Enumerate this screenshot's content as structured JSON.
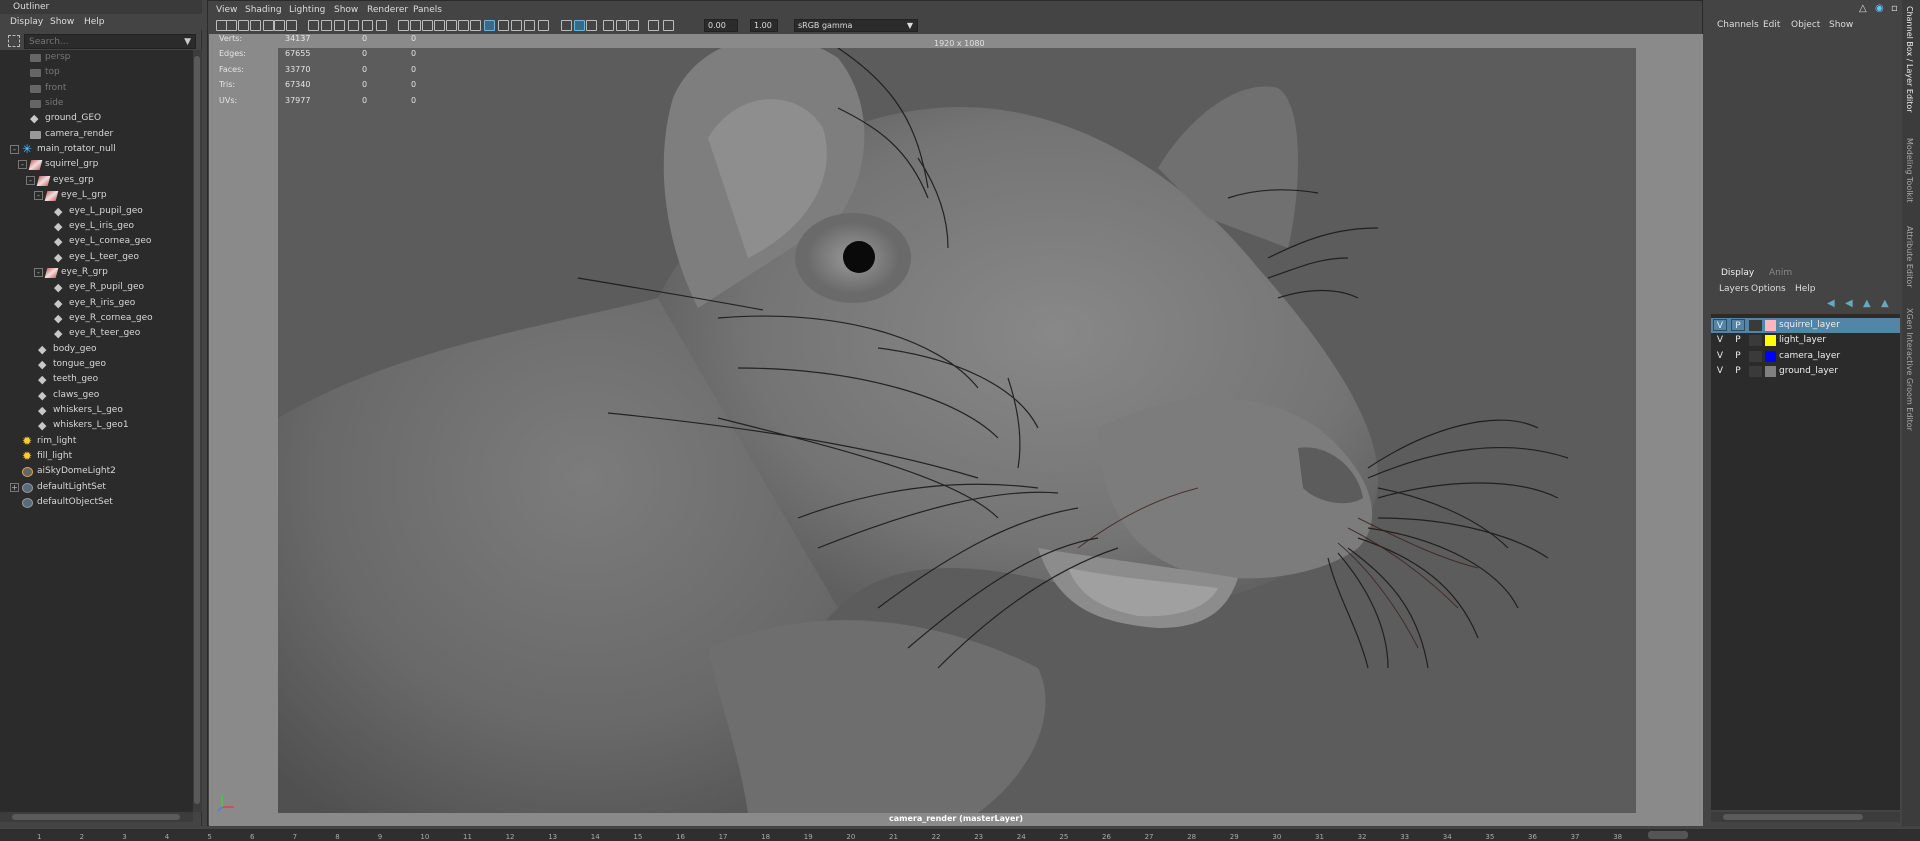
{
  "outliner": {
    "title": "Outliner",
    "menus": [
      "Display",
      "Show",
      "Help"
    ],
    "search_placeholder": "Search...",
    "items": [
      {
        "label": "persp",
        "type": "camera",
        "dim": true
      },
      {
        "label": "top",
        "type": "camera",
        "dim": true
      },
      {
        "label": "front",
        "type": "camera",
        "dim": true
      },
      {
        "label": "side",
        "type": "camera",
        "dim": true
      },
      {
        "label": "ground_GEO",
        "type": "mesh"
      },
      {
        "label": "camera_render",
        "type": "camera"
      },
      {
        "label": "main_rotator_null",
        "type": "null",
        "expanded": true
      },
      {
        "label": "squirrel_grp",
        "type": "group",
        "expanded": true
      },
      {
        "label": "eyes_grp",
        "type": "group",
        "expanded": true
      },
      {
        "label": "eye_L_grp",
        "type": "group",
        "expanded": true
      },
      {
        "label": "eye_L_pupil_geo",
        "type": "mesh"
      },
      {
        "label": "eye_L_iris_geo",
        "type": "mesh"
      },
      {
        "label": "eye_L_cornea_geo",
        "type": "mesh"
      },
      {
        "label": "eye_L_teer_geo",
        "type": "mesh"
      },
      {
        "label": "eye_R_grp",
        "type": "group",
        "expanded": true
      },
      {
        "label": "eye_R_pupil_geo",
        "type": "mesh"
      },
      {
        "label": "eye_R_iris_geo",
        "type": "mesh"
      },
      {
        "label": "eye_R_cornea_geo",
        "type": "mesh"
      },
      {
        "label": "eye_R_teer_geo",
        "type": "mesh"
      },
      {
        "label": "body_geo",
        "type": "mesh"
      },
      {
        "label": "tongue_geo",
        "type": "mesh"
      },
      {
        "label": "teeth_geo",
        "type": "mesh"
      },
      {
        "label": "claws_geo",
        "type": "mesh"
      },
      {
        "label": "whiskers_L_geo",
        "type": "mesh"
      },
      {
        "label": "whiskers_L_geo1",
        "type": "mesh"
      },
      {
        "label": "rim_light",
        "type": "light"
      },
      {
        "label": "fill_light",
        "type": "light"
      },
      {
        "label": "aiSkyDomeLight2",
        "type": "dome"
      },
      {
        "label": "defaultLightSet",
        "type": "set",
        "expandable": true
      },
      {
        "label": "defaultObjectSet",
        "type": "set"
      }
    ]
  },
  "viewport": {
    "menus": [
      "View",
      "Shading",
      "Lighting",
      "Show",
      "Renderer",
      "Panels"
    ],
    "exposure": "0.00",
    "gamma": "1.00",
    "color_space": "sRGB gamma",
    "resolution": "1920 x 1080",
    "camera_label": "camera_render (masterLayer)",
    "hud": [
      {
        "name": "Verts:",
        "values": [
          "34137",
          "0",
          "0"
        ]
      },
      {
        "name": "Edges:",
        "values": [
          "67655",
          "0",
          "0"
        ]
      },
      {
        "name": "Faces:",
        "values": [
          "33770",
          "0",
          "0"
        ]
      },
      {
        "name": "Tris:",
        "values": [
          "67340",
          "0",
          "0"
        ]
      },
      {
        "name": "UVs:",
        "values": [
          "37977",
          "0",
          "0"
        ]
      }
    ]
  },
  "channel_box": {
    "menus": [
      "Channels",
      "Edit",
      "Object",
      "Show"
    ]
  },
  "side_tabs": [
    "Channel Box / Layer Editor",
    "Modeling Toolkit",
    "Attribute Editor",
    "XGen Interactive Groom Editor"
  ],
  "layer_editor": {
    "tabs": [
      "Display",
      "Anim"
    ],
    "menus": [
      "Layers",
      "Options",
      "Help"
    ],
    "layers": [
      {
        "v": "V",
        "p": "P",
        "color": "#ffb6c1",
        "name": "squirrel_layer",
        "selected": true
      },
      {
        "v": "V",
        "p": "P",
        "color": "#ffff00",
        "name": "light_layer"
      },
      {
        "v": "V",
        "p": "P",
        "color": "#0000ff",
        "name": "camera_layer"
      },
      {
        "v": "V",
        "p": "P",
        "color": "#808080",
        "name": "ground_layer"
      }
    ]
  },
  "timeline": {
    "ticks": [
      "1",
      "2",
      "3",
      "4",
      "5",
      "6",
      "7",
      "8",
      "9",
      "10",
      "11",
      "12",
      "13",
      "14",
      "15",
      "16",
      "17",
      "18",
      "19",
      "20",
      "21",
      "22",
      "23",
      "24",
      "25",
      "26",
      "27",
      "28",
      "29",
      "30",
      "31",
      "32",
      "33",
      "34",
      "35",
      "36",
      "37",
      "38"
    ]
  }
}
